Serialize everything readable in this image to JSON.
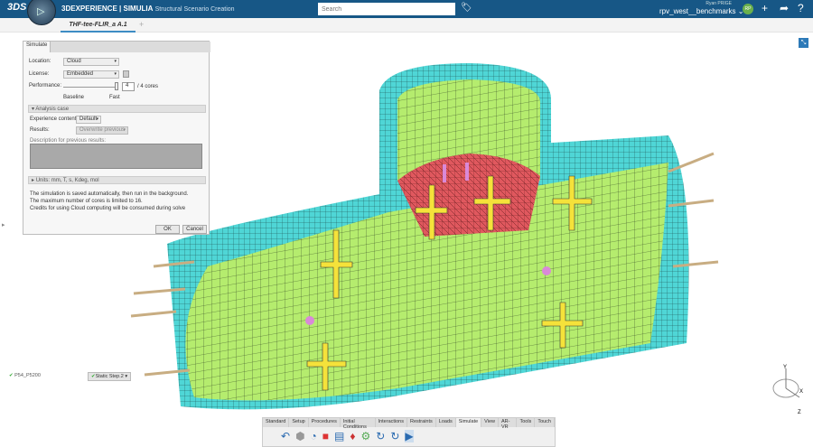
{
  "header": {
    "logo": "3DS",
    "app_title_bold": "3DEXPERIENCE | SIMULIA",
    "app_subtitle": "Structural Scenario Creation",
    "search_placeholder": "Search",
    "user_name": "Ryan PRIGE",
    "workspace": "rpv_west__benchmarks",
    "avatar": "RP",
    "icons": [
      "tag-icon",
      "plus-icon",
      "share-icon",
      "help-icon"
    ]
  },
  "tabs": {
    "active": "THF-tee-FLIR_a A.1",
    "add": "+"
  },
  "dialog": {
    "tab": "Simulate",
    "location_label": "Location:",
    "location_value": "Cloud",
    "license_label": "License:",
    "license_value": "Embedded",
    "performance_label": "Performance:",
    "cores_value": "4",
    "cores_suffix": "/ 4 cores",
    "performance_level": 1.0,
    "baseline": "Baseline",
    "fast": "Fast",
    "analysis_case": "Analysis case",
    "experience_label": "Experience content:",
    "experience_value": "Default",
    "results_label": "Results:",
    "results_value": "Overwrite previous",
    "description_label": "Description for previous results:",
    "units": "Units: mm, T, s, Kdeg, mol",
    "info": [
      "The simulation is saved automatically, then run in the background.",
      "The maximum number of cores is limited to 16.",
      "Credits for using Cloud computing will be consumed during solve"
    ],
    "ok": "OK",
    "cancel": "Cancel"
  },
  "tree": {
    "item": "P54_P5200",
    "step": "Static Step.2"
  },
  "toolbar": {
    "tabs": [
      "Standard",
      "Setup",
      "Procedures",
      "Initial Conditions",
      "Interactions",
      "Restraints",
      "Loads",
      "Simulate",
      "View",
      "AR-VR",
      "Tools",
      "Touch"
    ],
    "active": "Simulate"
  },
  "gizmo": {
    "x": "X",
    "y": "Y",
    "z": "Z"
  },
  "colors": {
    "header": "#175786",
    "mesh_inner": "#b5ec6e",
    "mesh_outer": "#4fd6d6",
    "contact": "#e0585e",
    "load_arrow": "#f5e23a"
  }
}
